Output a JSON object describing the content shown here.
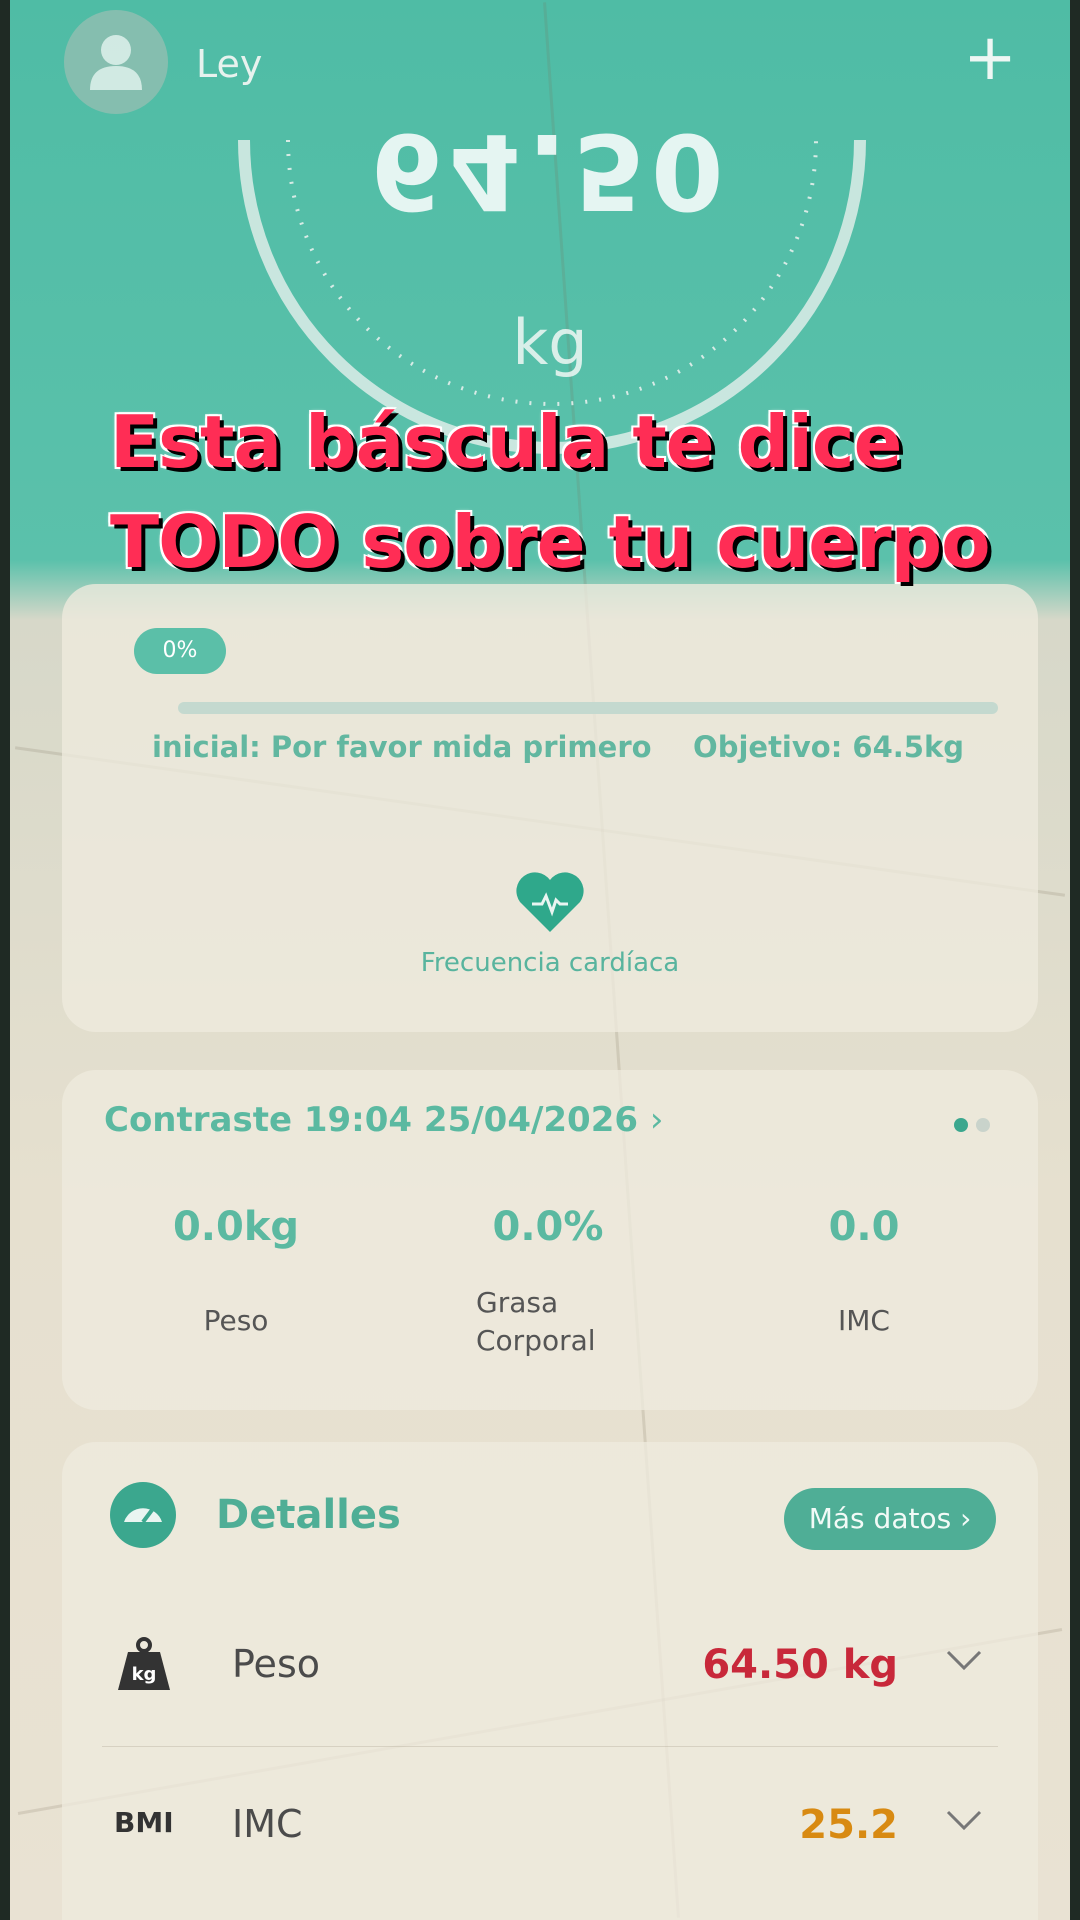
{
  "header": {
    "user_name": "Ley",
    "add_glyph": "+"
  },
  "gauge": {
    "weight_mirrored": "64.50",
    "unit": "kg"
  },
  "caption": {
    "line1": "Esta báscula te dice",
    "line2": "TODO sobre tu cuerpo"
  },
  "goal_card": {
    "progress_label": "0%",
    "progress": 0,
    "initial_text": "inicial: Por favor mida primero",
    "goal_text": "Objetivo: 64.5kg",
    "heart_rate_label": "Frecuencia cardíaca"
  },
  "contrast_card": {
    "title": "Contraste 19:04 25/04/2026",
    "chevron": "›",
    "metrics": [
      {
        "value": "0.0kg",
        "label": "Peso"
      },
      {
        "value": "0.0%",
        "label": "Grasa Corporal"
      },
      {
        "value": "0.0",
        "label": "IMC"
      }
    ],
    "page_dots": 2,
    "active_dot": 0
  },
  "details_card": {
    "title": "Detalles",
    "more_button": "Más datos ›",
    "rows": [
      {
        "icon": "kg-weight-icon",
        "icon_text": "kg",
        "label": "Peso",
        "value": "64.50 kg",
        "value_color": "#c8283a"
      },
      {
        "icon": "bmi-icon",
        "icon_text": "BMI",
        "label": "IMC",
        "value": "25.2",
        "value_color": "#d88a12"
      }
    ]
  },
  "colors": {
    "accent": "#5bbfa8",
    "caption_red": "#ff2d55"
  }
}
